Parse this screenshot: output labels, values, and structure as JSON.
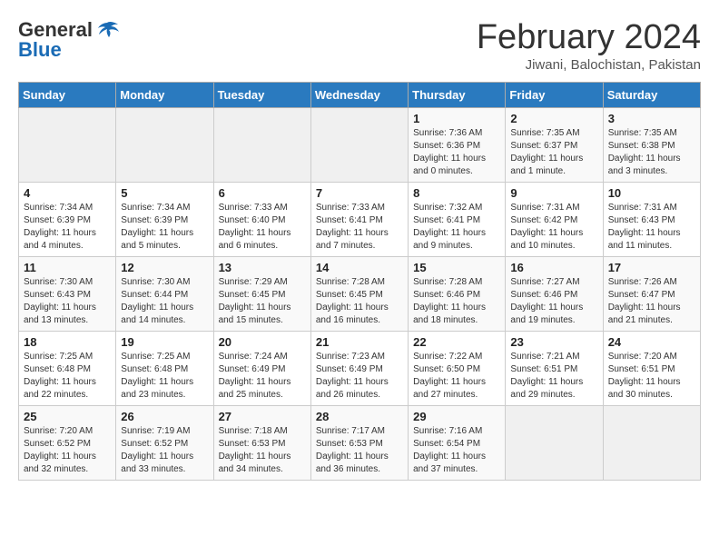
{
  "header": {
    "logo_general": "General",
    "logo_blue": "Blue",
    "month_title": "February 2024",
    "location": "Jiwani, Balochistan, Pakistan"
  },
  "days_of_week": [
    "Sunday",
    "Monday",
    "Tuesday",
    "Wednesday",
    "Thursday",
    "Friday",
    "Saturday"
  ],
  "weeks": [
    [
      {
        "day": "",
        "info": ""
      },
      {
        "day": "",
        "info": ""
      },
      {
        "day": "",
        "info": ""
      },
      {
        "day": "",
        "info": ""
      },
      {
        "day": "1",
        "info": "Sunrise: 7:36 AM\nSunset: 6:36 PM\nDaylight: 11 hours and 0 minutes."
      },
      {
        "day": "2",
        "info": "Sunrise: 7:35 AM\nSunset: 6:37 PM\nDaylight: 11 hours and 1 minute."
      },
      {
        "day": "3",
        "info": "Sunrise: 7:35 AM\nSunset: 6:38 PM\nDaylight: 11 hours and 3 minutes."
      }
    ],
    [
      {
        "day": "4",
        "info": "Sunrise: 7:34 AM\nSunset: 6:39 PM\nDaylight: 11 hours and 4 minutes."
      },
      {
        "day": "5",
        "info": "Sunrise: 7:34 AM\nSunset: 6:39 PM\nDaylight: 11 hours and 5 minutes."
      },
      {
        "day": "6",
        "info": "Sunrise: 7:33 AM\nSunset: 6:40 PM\nDaylight: 11 hours and 6 minutes."
      },
      {
        "day": "7",
        "info": "Sunrise: 7:33 AM\nSunset: 6:41 PM\nDaylight: 11 hours and 7 minutes."
      },
      {
        "day": "8",
        "info": "Sunrise: 7:32 AM\nSunset: 6:41 PM\nDaylight: 11 hours and 9 minutes."
      },
      {
        "day": "9",
        "info": "Sunrise: 7:31 AM\nSunset: 6:42 PM\nDaylight: 11 hours and 10 minutes."
      },
      {
        "day": "10",
        "info": "Sunrise: 7:31 AM\nSunset: 6:43 PM\nDaylight: 11 hours and 11 minutes."
      }
    ],
    [
      {
        "day": "11",
        "info": "Sunrise: 7:30 AM\nSunset: 6:43 PM\nDaylight: 11 hours and 13 minutes."
      },
      {
        "day": "12",
        "info": "Sunrise: 7:30 AM\nSunset: 6:44 PM\nDaylight: 11 hours and 14 minutes."
      },
      {
        "day": "13",
        "info": "Sunrise: 7:29 AM\nSunset: 6:45 PM\nDaylight: 11 hours and 15 minutes."
      },
      {
        "day": "14",
        "info": "Sunrise: 7:28 AM\nSunset: 6:45 PM\nDaylight: 11 hours and 16 minutes."
      },
      {
        "day": "15",
        "info": "Sunrise: 7:28 AM\nSunset: 6:46 PM\nDaylight: 11 hours and 18 minutes."
      },
      {
        "day": "16",
        "info": "Sunrise: 7:27 AM\nSunset: 6:46 PM\nDaylight: 11 hours and 19 minutes."
      },
      {
        "day": "17",
        "info": "Sunrise: 7:26 AM\nSunset: 6:47 PM\nDaylight: 11 hours and 21 minutes."
      }
    ],
    [
      {
        "day": "18",
        "info": "Sunrise: 7:25 AM\nSunset: 6:48 PM\nDaylight: 11 hours and 22 minutes."
      },
      {
        "day": "19",
        "info": "Sunrise: 7:25 AM\nSunset: 6:48 PM\nDaylight: 11 hours and 23 minutes."
      },
      {
        "day": "20",
        "info": "Sunrise: 7:24 AM\nSunset: 6:49 PM\nDaylight: 11 hours and 25 minutes."
      },
      {
        "day": "21",
        "info": "Sunrise: 7:23 AM\nSunset: 6:49 PM\nDaylight: 11 hours and 26 minutes."
      },
      {
        "day": "22",
        "info": "Sunrise: 7:22 AM\nSunset: 6:50 PM\nDaylight: 11 hours and 27 minutes."
      },
      {
        "day": "23",
        "info": "Sunrise: 7:21 AM\nSunset: 6:51 PM\nDaylight: 11 hours and 29 minutes."
      },
      {
        "day": "24",
        "info": "Sunrise: 7:20 AM\nSunset: 6:51 PM\nDaylight: 11 hours and 30 minutes."
      }
    ],
    [
      {
        "day": "25",
        "info": "Sunrise: 7:20 AM\nSunset: 6:52 PM\nDaylight: 11 hours and 32 minutes."
      },
      {
        "day": "26",
        "info": "Sunrise: 7:19 AM\nSunset: 6:52 PM\nDaylight: 11 hours and 33 minutes."
      },
      {
        "day": "27",
        "info": "Sunrise: 7:18 AM\nSunset: 6:53 PM\nDaylight: 11 hours and 34 minutes."
      },
      {
        "day": "28",
        "info": "Sunrise: 7:17 AM\nSunset: 6:53 PM\nDaylight: 11 hours and 36 minutes."
      },
      {
        "day": "29",
        "info": "Sunrise: 7:16 AM\nSunset: 6:54 PM\nDaylight: 11 hours and 37 minutes."
      },
      {
        "day": "",
        "info": ""
      },
      {
        "day": "",
        "info": ""
      }
    ]
  ]
}
